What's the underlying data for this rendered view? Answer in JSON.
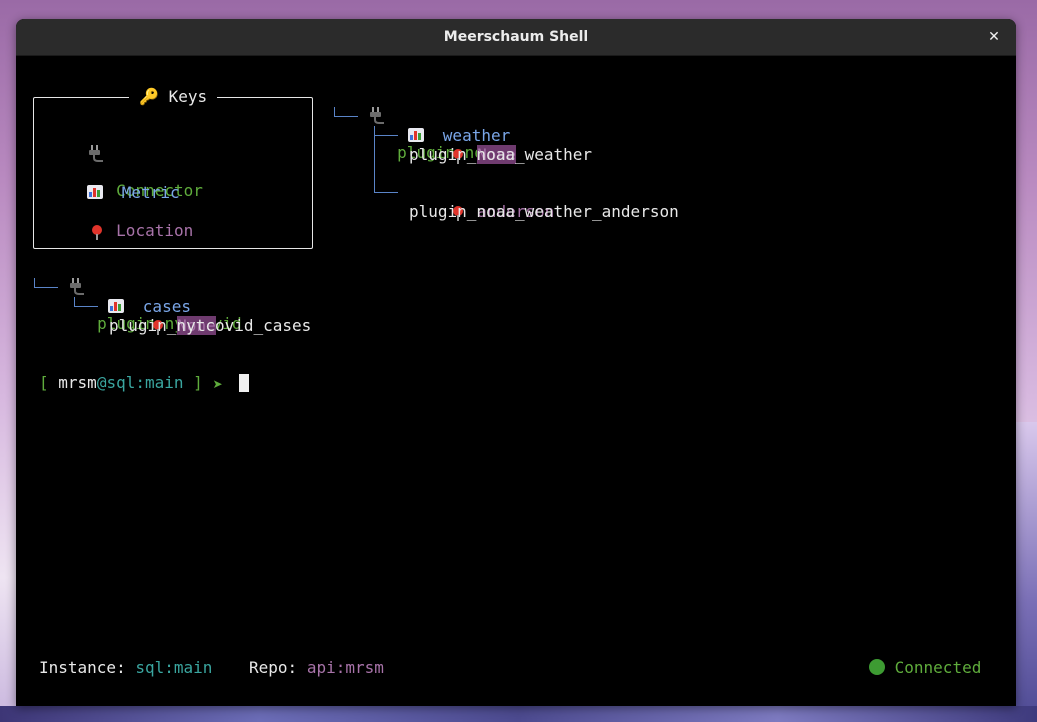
{
  "window": {
    "title": "Meerschaum Shell"
  },
  "keys": {
    "title": "Keys",
    "connector_label": "Connector",
    "metric_label": "Metric",
    "location_label": "Location"
  },
  "tree": {
    "noaa": {
      "connector": "plugin:noaa",
      "metric": "weather",
      "loc1": "None",
      "pipe1": "plugin_noaa_weather",
      "loc2": "anderson",
      "pipe2": "plugin_noaa_weather_anderson"
    },
    "nytcovid": {
      "connector": "plugin:nytcovid",
      "metric": "cases",
      "loc1": "None",
      "pipe1": "plugin_nytcovid_cases"
    }
  },
  "prompt": {
    "open": "[",
    "user": "mrsm",
    "at_instance": "@sql:main",
    "close": "]",
    "arrow": "➤"
  },
  "status": {
    "instance_label": "Instance:",
    "instance_value": "sql:main",
    "repo_label": "Repo:",
    "repo_value": "api:mrsm",
    "connection": "Connected"
  },
  "colors": {
    "connector": "#5fac3c",
    "metric": "#7aa6e8",
    "location": "#a873a9",
    "instance": "#3aa6a0"
  },
  "icons": [
    "plug-icon",
    "bar-chart-icon",
    "pin-icon",
    "key-icon",
    "close-icon",
    "status-dot-icon"
  ]
}
